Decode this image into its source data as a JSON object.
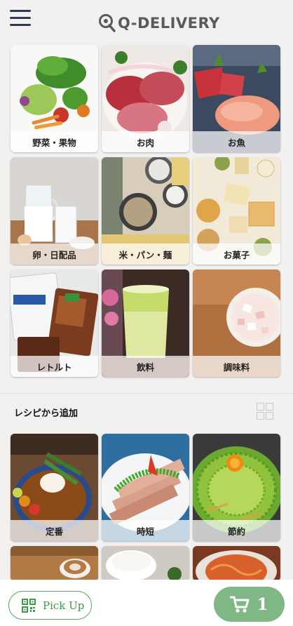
{
  "header": {
    "brand": "Q-DELIVERY"
  },
  "categories": [
    {
      "label": "野菜・果物",
      "icon": "vegetables-fruits-photo"
    },
    {
      "label": "お肉",
      "icon": "meat-photo"
    },
    {
      "label": "お魚",
      "icon": "fish-photo"
    },
    {
      "label": "卵・日配品",
      "icon": "eggs-dairy-photo"
    },
    {
      "label": "米・パン・麺",
      "icon": "rice-bread-noodles-photo"
    },
    {
      "label": "お菓子",
      "icon": "sweets-photo"
    },
    {
      "label": "レトルト",
      "icon": "retort-food-photo"
    },
    {
      "label": "飲料",
      "icon": "drinks-photo"
    },
    {
      "label": "調味料",
      "icon": "seasoning-photo"
    }
  ],
  "recipes": {
    "title": "レシピから追加",
    "items": [
      {
        "label": "定番",
        "icon": "curry-photo"
      },
      {
        "label": "時短",
        "icon": "quick-meal-photo"
      },
      {
        "label": "節約",
        "icon": "budget-meal-photo"
      },
      {
        "label": "",
        "icon": "coffee-photo"
      },
      {
        "label": "",
        "icon": "rice-bowl-photo"
      },
      {
        "label": "",
        "icon": "pasta-photo"
      }
    ]
  },
  "bottom_bar": {
    "pickup_label": "Pick Up",
    "cart_count": "1"
  },
  "colors": {
    "accent_green": "#58a55f",
    "cart_green": "#7fb884",
    "menu_navy": "#2e3a55",
    "background": "#f2f1ef"
  }
}
